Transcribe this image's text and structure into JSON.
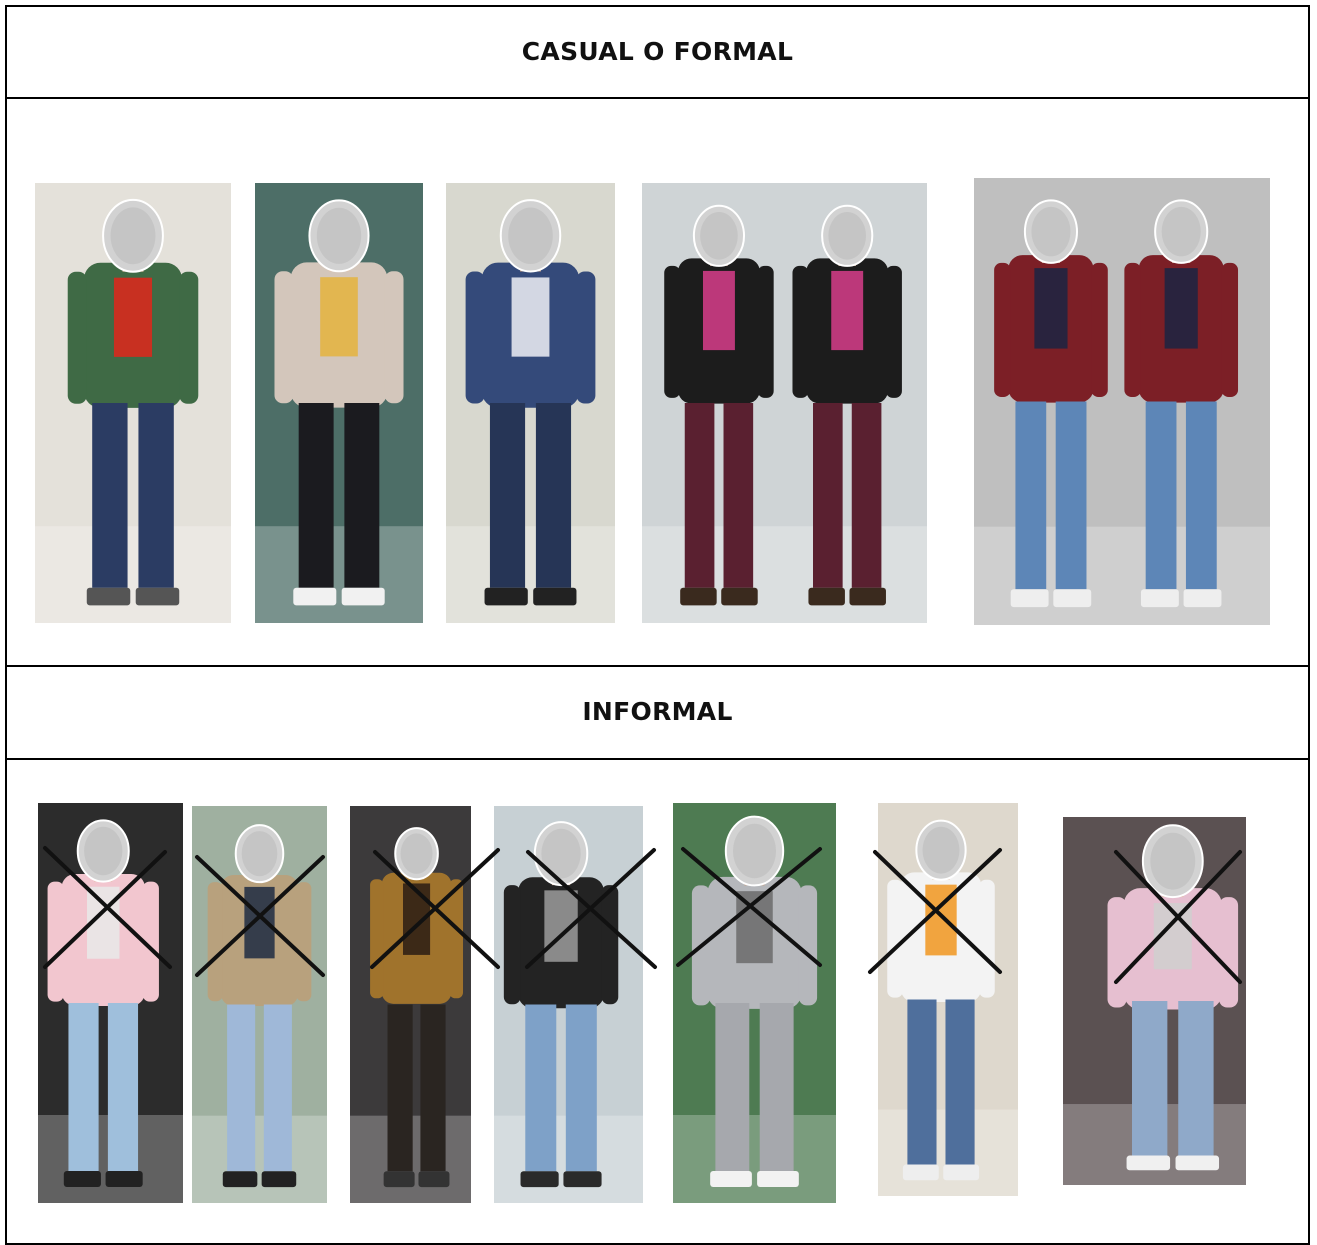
{
  "sections": {
    "casual_formal": {
      "title": "CASUAL O FORMAL",
      "photos": [
        {
          "name": "photo-man-green-shirt",
          "bg": "#e4e1da",
          "top": "#3f6a45",
          "bottom": "#2b3c63",
          "skin": "#d9b79c",
          "accent": "#e0261b",
          "shoes": "#555555"
        },
        {
          "name": "photo-woman-cardigan",
          "bg": "#4d6e67",
          "top": "#d3c6bb",
          "bottom": "#1b1b1f",
          "skin": "#e3c2a6",
          "accent": "#e4b33d",
          "shoes": "#f1f1f1"
        },
        {
          "name": "photo-man-blazer",
          "bg": "#d8d8cf",
          "top": "#344a7a",
          "bottom": "#263556",
          "skin": "#c89f81",
          "accent": "#f0f0f6",
          "shoes": "#222222"
        },
        {
          "name": "photo-two-women",
          "bg": "#cfd4d6",
          "top": "#1c1c1c",
          "bottom": "#5a2030",
          "skin": "#d7b096",
          "accent": "#d83d8b",
          "shoes": "#3a2a1e"
        },
        {
          "name": "photo-two-men",
          "bg": "#bfbfbf",
          "top": "#7c1f26",
          "bottom": "#5d86b7",
          "skin": "#d6b097",
          "accent": "#1b2443",
          "shoes": "#eeeeee"
        }
      ]
    },
    "informal": {
      "title": "INFORMAL",
      "photos": [
        {
          "name": "photo-pink-jacket",
          "bg": "#2c2c2c",
          "top": "#f2c6cf",
          "bottom": "#9fbfdc",
          "skin": "#e0bea5",
          "accent": "#e9e9e9",
          "shoes": "#222222"
        },
        {
          "name": "photo-tan-hoodie-shorts",
          "bg": "#9fb0a0",
          "top": "#b8a17d",
          "bottom": "#9fb8d8",
          "skin": "#c9a287",
          "accent": "#1d2b42",
          "shoes": "#222222"
        },
        {
          "name": "photo-leopard-top",
          "bg": "#3c3a3b",
          "top": "#a0732c",
          "bottom": "#2a2521",
          "skin": "#d7b398",
          "accent": "#2a1c14",
          "shoes": "#333333"
        },
        {
          "name": "photo-leather-jacket",
          "bg": "#c7d0d4",
          "top": "#232323",
          "bottom": "#7ea1c8",
          "skin": "#d8b59c",
          "accent": "#9c9c9c",
          "shoes": "#2a2a2a"
        },
        {
          "name": "photo-grey-sweatsuit",
          "bg": "#4e7b52",
          "top": "#b5b7bb",
          "bottom": "#a6a8ad",
          "skin": "#c8a083",
          "accent": "#6b6b6b",
          "shoes": "#f2f2f2"
        },
        {
          "name": "photo-white-top-ripped-jeans",
          "bg": "#ded8cd",
          "top": "#f3f3f3",
          "bottom": "#4f6f9c",
          "skin": "#e3c1a8",
          "accent": "#f0951f",
          "shoes": "#eeeeee"
        },
        {
          "name": "photo-seated-pink-sweater",
          "bg": "#5b5152",
          "top": "#e6bfd0",
          "bottom": "#8fa9c9",
          "skin": "#dcb9a0",
          "accent": "#cfcfcf",
          "shoes": "#f0f0f0"
        }
      ]
    }
  }
}
